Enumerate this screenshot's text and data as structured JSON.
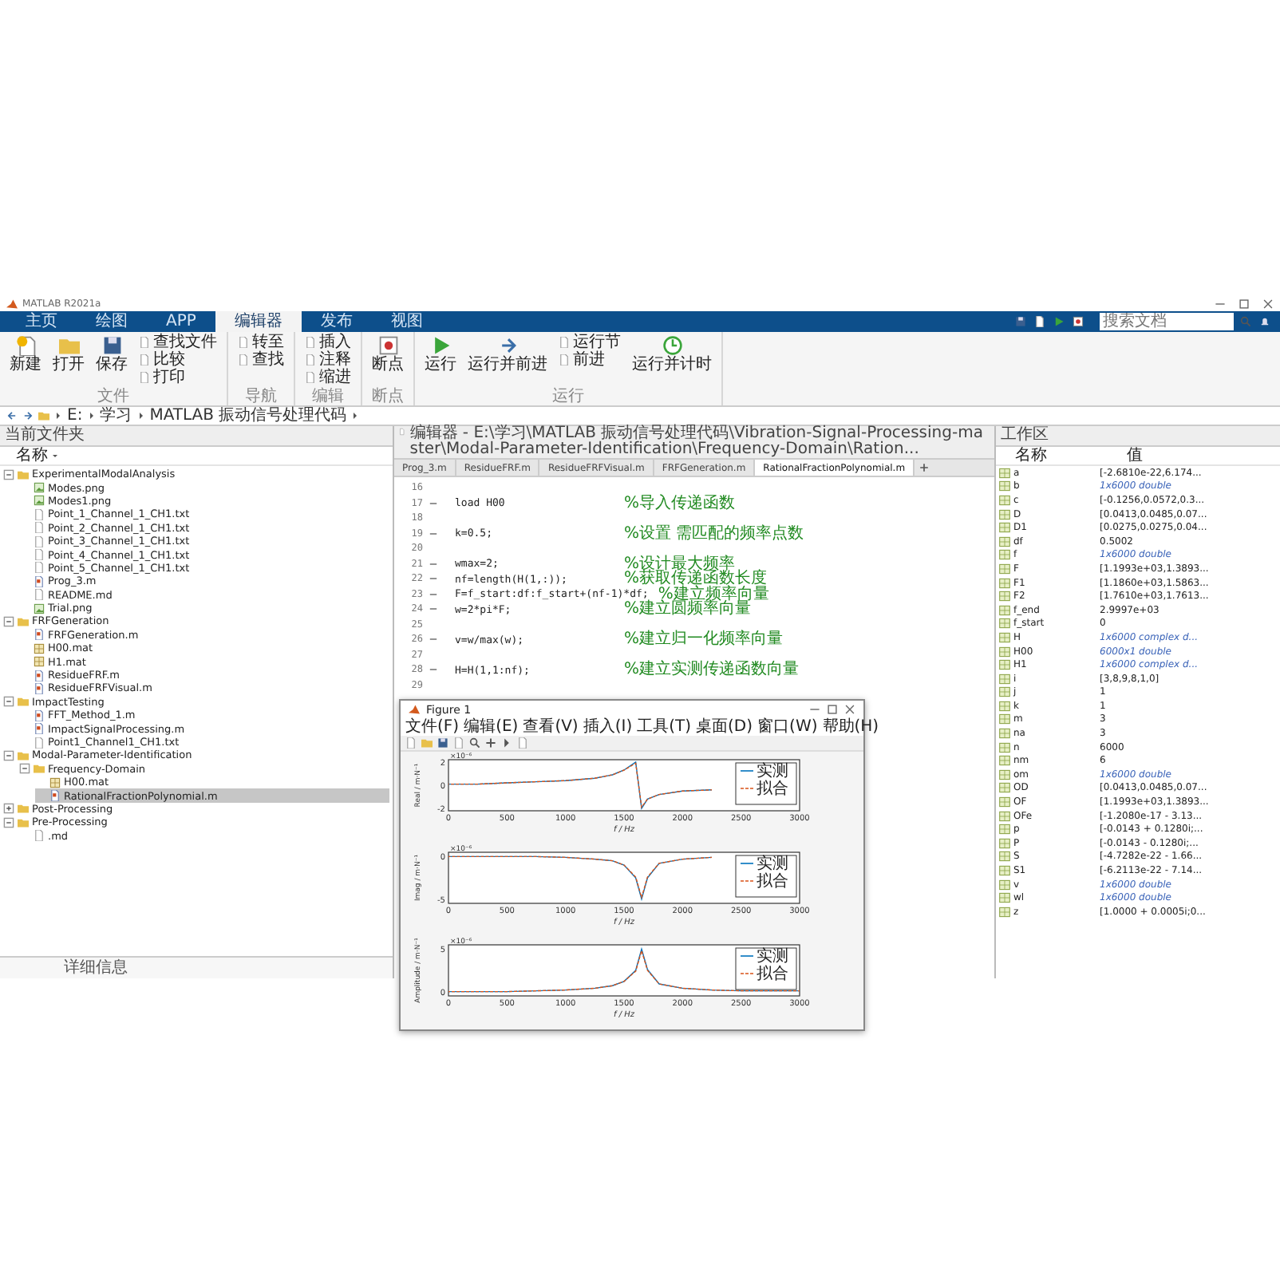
{
  "window": {
    "title": "MATLAB R2021a"
  },
  "ribbon_tabs": [
    {
      "label": "主页",
      "selected": false
    },
    {
      "label": "绘图",
      "selected": false
    },
    {
      "label": "APP",
      "selected": false
    },
    {
      "label": "编辑器",
      "selected": true
    },
    {
      "label": "发布",
      "selected": false
    },
    {
      "label": "视图",
      "selected": false
    }
  ],
  "search": {
    "placeholder": "搜索文档"
  },
  "toolstrip": [
    {
      "label": "文件",
      "buttons": [
        {
          "label": "新建",
          "kind": "large"
        },
        {
          "label": "打开",
          "kind": "large"
        },
        {
          "label": "保存",
          "kind": "large"
        },
        {
          "label": "查找文件",
          "kind": "small"
        },
        {
          "label": "比较",
          "kind": "small"
        },
        {
          "label": "打印",
          "kind": "small"
        }
      ]
    },
    {
      "label": "导航",
      "buttons": [
        {
          "label": "转至",
          "kind": "small"
        },
        {
          "label": "查找",
          "kind": "small"
        }
      ]
    },
    {
      "label": "编辑",
      "buttons": [
        {
          "label": "插入",
          "kind": "small"
        },
        {
          "label": "注释",
          "kind": "small"
        },
        {
          "label": "缩进",
          "kind": "small"
        }
      ]
    },
    {
      "label": "断点",
      "buttons": [
        {
          "label": "断点",
          "kind": "large"
        }
      ]
    },
    {
      "label": "运行",
      "buttons": [
        {
          "label": "运行",
          "kind": "large"
        },
        {
          "label": "运行并前进",
          "kind": "large"
        },
        {
          "label": "运行节",
          "kind": "small"
        },
        {
          "label": "前进",
          "kind": "small"
        },
        {
          "label": "运行并计时",
          "kind": "large"
        }
      ]
    }
  ],
  "address_bar": {
    "path": [
      "E:",
      "学习",
      "MATLAB 振动信号处理代码"
    ]
  },
  "current_folder": {
    "title": "当前文件夹",
    "column": "名称",
    "details": "详细信息",
    "tree": [
      {
        "name": "ExperimentalModalAnalysis",
        "kind": "folder",
        "expanded": true,
        "selected": false,
        "children": [
          {
            "name": "Modes.png",
            "kind": "png",
            "selected": false
          },
          {
            "name": "Modes1.png",
            "kind": "png",
            "selected": false
          },
          {
            "name": "Point_1_Channel_1_CH1.txt",
            "kind": "txt",
            "selected": false
          },
          {
            "name": "Point_2_Channel_1_CH1.txt",
            "kind": "txt",
            "selected": false
          },
          {
            "name": "Point_3_Channel_1_CH1.txt",
            "kind": "txt",
            "selected": false
          },
          {
            "name": "Point_4_Channel_1_CH1.txt",
            "kind": "txt",
            "selected": false
          },
          {
            "name": "Point_5_Channel_1_CH1.txt",
            "kind": "txt",
            "selected": false
          },
          {
            "name": "Prog_3.m",
            "kind": "m",
            "selected": false
          },
          {
            "name": "README.md",
            "kind": "md",
            "selected": false
          },
          {
            "name": "Trial.png",
            "kind": "png",
            "selected": false
          }
        ]
      },
      {
        "name": "FRFGeneration",
        "kind": "folder",
        "expanded": true,
        "selected": false,
        "children": [
          {
            "name": "FRFGeneration.m",
            "kind": "m",
            "selected": false
          },
          {
            "name": "H00.mat",
            "kind": "mat",
            "selected": false
          },
          {
            "name": "H1.mat",
            "kind": "mat",
            "selected": false
          },
          {
            "name": "ResidueFRF.m",
            "kind": "m",
            "selected": false
          },
          {
            "name": "ResidueFRFVisual.m",
            "kind": "m",
            "selected": false
          }
        ]
      },
      {
        "name": "ImpactTesting",
        "kind": "folder",
        "expanded": true,
        "selected": false,
        "children": [
          {
            "name": "FFT_Method_1.m",
            "kind": "m",
            "selected": false
          },
          {
            "name": "ImpactSignalProcessing.m",
            "kind": "m",
            "selected": false
          },
          {
            "name": "Point1_Channel1_CH1.txt",
            "kind": "txt",
            "selected": false
          }
        ]
      },
      {
        "name": "Modal-Parameter-Identification",
        "kind": "folder",
        "expanded": true,
        "selected": false,
        "children": [
          {
            "name": "Frequency-Domain",
            "kind": "folder",
            "expanded": true,
            "selected": false,
            "children": [
              {
                "name": "H00.mat",
                "kind": "mat",
                "selected": false
              },
              {
                "name": "RationalFractionPolynomial.m",
                "kind": "m",
                "selected": true
              }
            ]
          }
        ]
      },
      {
        "name": "Post-Processing",
        "kind": "folder",
        "expanded": false,
        "selected": false
      },
      {
        "name": "Pre-Processing",
        "kind": "folder",
        "expanded": true,
        "selected": false,
        "children": [
          {
            "name": ".md",
            "kind": "md",
            "selected": false
          }
        ]
      }
    ]
  },
  "editor": {
    "title": "编辑器 - E:\\学习\\MATLAB 振动信号处理代码\\Vibration-Signal-Processing-master\\Modal-Parameter-Identification\\Frequency-Domain\\Ration...",
    "tabs": [
      {
        "label": "Prog_3.m",
        "selected": false
      },
      {
        "label": "ResidueFRF.m",
        "selected": false
      },
      {
        "label": "ResidueFRFVisual.m",
        "selected": false
      },
      {
        "label": "FRFGeneration.m",
        "selected": false
      },
      {
        "label": "RationalFractionPolynomial.m",
        "selected": true
      }
    ],
    "lines": [
      {
        "number": "16",
        "executable": false
      },
      {
        "number": "17",
        "executable": true,
        "code": "load H00",
        "comment": "%导入传递函数"
      },
      {
        "number": "18",
        "executable": false
      },
      {
        "number": "19",
        "executable": true,
        "code": "k=0.5;",
        "comment": "%设置 需匹配的频率点数"
      },
      {
        "number": "20",
        "executable": false
      },
      {
        "number": "21",
        "executable": true,
        "code": "wmax=2;",
        "comment": "%设计最大频率"
      },
      {
        "number": "22",
        "executable": true,
        "code": "nf=length(H(1,:));",
        "comment": "%获取传递函数长度"
      },
      {
        "number": "23",
        "executable": true,
        "code": "F=f_start:df:f_start+(nf-1)*df;",
        "comment": "%建立频率向量"
      },
      {
        "number": "24",
        "executable": true,
        "code": "w=2*pi*F;",
        "comment": "%建立圆频率向量"
      },
      {
        "number": "25",
        "executable": false
      },
      {
        "number": "26",
        "executable": true,
        "code": "v=w/max(w);",
        "comment": "%建立归一化频率向量"
      },
      {
        "number": "27",
        "executable": false
      },
      {
        "number": "28",
        "executable": true,
        "code": "H=H(1,1:nf);",
        "comment": "%建立实测传递函数向量"
      },
      {
        "number": "29",
        "executable": false
      }
    ]
  },
  "workspace": {
    "title": "工作区",
    "columns": [
      "名称",
      "值"
    ],
    "rows": [
      {
        "name": "a",
        "value": "[-2.6810e-22,6.174...",
        "kind": "value"
      },
      {
        "name": "b",
        "value": "1x6000 double",
        "kind": "summary"
      },
      {
        "name": "c",
        "value": "[-0.1256,0.0572,0.3...",
        "kind": "value"
      },
      {
        "name": "D",
        "value": "[0.0413,0.0485,0.07...",
        "kind": "value"
      },
      {
        "name": "D1",
        "value": "[0.0275,0.0275,0.04...",
        "kind": "value"
      },
      {
        "name": "df",
        "value": "0.5002",
        "kind": "value"
      },
      {
        "name": "f",
        "value": "1x6000 double",
        "kind": "summary"
      },
      {
        "name": "F",
        "value": "[1.1993e+03,1.3893...",
        "kind": "value"
      },
      {
        "name": "F1",
        "value": "[1.1860e+03,1.5863...",
        "kind": "value"
      },
      {
        "name": "F2",
        "value": "[1.7610e+03,1.7613...",
        "kind": "value"
      },
      {
        "name": "f_end",
        "value": "2.9997e+03",
        "kind": "value"
      },
      {
        "name": "f_start",
        "value": "0",
        "kind": "value"
      },
      {
        "name": "H",
        "value": "1x6000 complex d...",
        "kind": "summary"
      },
      {
        "name": "H00",
        "value": "6000x1 double",
        "kind": "summary"
      },
      {
        "name": "H1",
        "value": "1x6000 complex d...",
        "kind": "summary"
      },
      {
        "name": "i",
        "value": "[3,8,9,8,1,0]",
        "kind": "value"
      },
      {
        "name": "j",
        "value": "1",
        "kind": "value"
      },
      {
        "name": "k",
        "value": "1",
        "kind": "value"
      },
      {
        "name": "m",
        "value": "3",
        "kind": "value"
      },
      {
        "name": "na",
        "value": "3",
        "kind": "value"
      },
      {
        "name": "n",
        "value": "6000",
        "kind": "value"
      },
      {
        "name": "nm",
        "value": "6",
        "kind": "value"
      },
      {
        "name": "om",
        "value": "1x6000 double",
        "kind": "summary"
      },
      {
        "name": "OD",
        "value": "[0.0413,0.0485,0.07...",
        "kind": "value"
      },
      {
        "name": "OF",
        "value": "[1.1993e+03,1.3893...",
        "kind": "value"
      },
      {
        "name": "OFe",
        "value": "[-1.2080e-17 - 3.13...",
        "kind": "value"
      },
      {
        "name": "p",
        "value": "[-0.0143 + 0.1280i;...",
        "kind": "value"
      },
      {
        "name": "P",
        "value": "[-0.0143 - 0.1280i;...",
        "kind": "value"
      },
      {
        "name": "S",
        "value": "[-4.7282e-22 - 1.66...",
        "kind": "value"
      },
      {
        "name": "S1",
        "value": "[-6.2113e-22 - 7.14...",
        "kind": "value"
      },
      {
        "name": "v",
        "value": "1x6000 double",
        "kind": "summary"
      },
      {
        "name": "wl",
        "value": "1x6000 double",
        "kind": "summary"
      },
      {
        "name": "z",
        "value": "[1.0000 + 0.0005i;0...",
        "kind": "value"
      }
    ]
  },
  "figure": {
    "title": "Figure 1",
    "menu": [
      "文件(F)",
      "编辑(E)",
      "查看(V)",
      "插入(I)",
      "工具(T)",
      "桌面(D)",
      "窗口(W)",
      "帮助(H)"
    ],
    "plots": [
      {
        "chart_data": {
          "type": "line",
          "xlabel": "f / Hz",
          "ylabel": "Real / m·N⁻¹",
          "x": [
            0,
            250,
            500,
            750,
            1000,
            1250,
            1400,
            1500,
            1600,
            1650,
            1700,
            1800,
            2000,
            2250
          ],
          "series": [
            {
              "name": "实测",
              "color": "#0072bd",
              "line_style": "solid",
              "values": [
                0.1,
                0.1,
                0.2,
                0.3,
                0.4,
                0.6,
                0.9,
                1.3,
                2,
                -2,
                -1.2,
                -0.8,
                -0.5,
                -0.4
              ]
            },
            {
              "name": "拟合",
              "color": "#d95319",
              "line_style": "dashed",
              "values": [
                0.1,
                0.1,
                0.2,
                0.3,
                0.4,
                0.6,
                0.9,
                1.3,
                1.9,
                -1.9,
                -1.2,
                -0.8,
                -0.5,
                -0.4
              ]
            }
          ],
          "legend": true,
          "xlim": [
            0,
            3000
          ],
          "ylim": [
            -2.2,
            2.2
          ],
          "xticks": [
            {
              "value": 0,
              "label": "0"
            },
            {
              "value": 500,
              "label": "500"
            },
            {
              "value": 1000,
              "label": "1000"
            },
            {
              "value": 1500,
              "label": "1500"
            },
            {
              "value": 2000,
              "label": "2000"
            },
            {
              "value": 2500,
              "label": "2500"
            },
            {
              "value": 3000,
              "label": "3000"
            }
          ],
          "yticks": [
            {
              "value": -2,
              "label": "-2"
            },
            {
              "value": 0,
              "label": "0"
            },
            {
              "value": 2,
              "label": "2"
            }
          ],
          "annotations": [
            "×10⁻⁶"
          ]
        }
      },
      {
        "chart_data": {
          "type": "line",
          "xlabel": "f / Hz",
          "ylabel": "Imag / m·N⁻¹",
          "x": [
            0,
            250,
            500,
            750,
            1000,
            1250,
            1400,
            1500,
            1600,
            1650,
            1700,
            1800,
            2000,
            2250
          ],
          "series": [
            {
              "name": "实测",
              "color": "#0072bd",
              "line_style": "solid",
              "values": [
                0,
                0,
                0,
                0,
                -0.1,
                -0.3,
                -0.5,
                -1,
                -2.5,
                -5,
                -2.5,
                -0.8,
                -0.3,
                -0.1
              ]
            },
            {
              "name": "拟合",
              "color": "#d95319",
              "line_style": "dashed",
              "values": [
                0,
                0,
                0,
                0,
                -0.1,
                -0.3,
                -0.5,
                -1,
                -2.4,
                -4.8,
                -2.4,
                -0.8,
                -0.3,
                -0.1
              ]
            }
          ],
          "legend": true,
          "xlim": [
            0,
            3000
          ],
          "ylim": [
            -5.5,
            0.5
          ],
          "xticks": [
            {
              "value": 0,
              "label": "0"
            },
            {
              "value": 500,
              "label": "500"
            },
            {
              "value": 1000,
              "label": "1000"
            },
            {
              "value": 1500,
              "label": "1500"
            },
            {
              "value": 2000,
              "label": "2000"
            },
            {
              "value": 2500,
              "label": "2500"
            },
            {
              "value": 3000,
              "label": "3000"
            }
          ],
          "yticks": [
            {
              "value": -5,
              "label": "-5"
            },
            {
              "value": 0,
              "label": "0"
            }
          ],
          "annotations": [
            "×10⁻⁶"
          ]
        }
      },
      {
        "chart_data": {
          "type": "line",
          "xlabel": "f / Hz",
          "ylabel": "Amplitude / m·N⁻¹",
          "x": [
            0,
            250,
            500,
            750,
            1000,
            1250,
            1400,
            1500,
            1600,
            1650,
            1700,
            1800,
            2000,
            2250,
            2500,
            2750,
            3000
          ],
          "series": [
            {
              "name": "实测",
              "color": "#0072bd",
              "line_style": "solid",
              "values": [
                0,
                0,
                0,
                0.1,
                0.2,
                0.4,
                0.7,
                1.2,
                2.5,
                5,
                2.6,
                0.9,
                0.4,
                0.2,
                0.1,
                0.1,
                0.1
              ]
            },
            {
              "name": "拟合",
              "color": "#d95319",
              "line_style": "dashed",
              "values": [
                0,
                0,
                0,
                0.1,
                0.2,
                0.4,
                0.7,
                1.2,
                2.4,
                4.8,
                2.5,
                0.9,
                0.4,
                0.2,
                0.1,
                0.1,
                0.1
              ]
            }
          ],
          "legend": true,
          "xlim": [
            0,
            3000
          ],
          "ylim": [
            -0.5,
            5.5
          ],
          "xticks": [
            {
              "value": 0,
              "label": "0"
            },
            {
              "value": 500,
              "label": "500"
            },
            {
              "value": 1000,
              "label": "1000"
            },
            {
              "value": 1500,
              "label": "1500"
            },
            {
              "value": 2000,
              "label": "2000"
            },
            {
              "value": 2500,
              "label": "2500"
            },
            {
              "value": 3000,
              "label": "3000"
            }
          ],
          "yticks": [
            {
              "value": 0,
              "label": "0"
            },
            {
              "value": 5,
              "label": "5"
            }
          ],
          "annotations": [
            "×10⁻⁶"
          ]
        }
      }
    ]
  }
}
